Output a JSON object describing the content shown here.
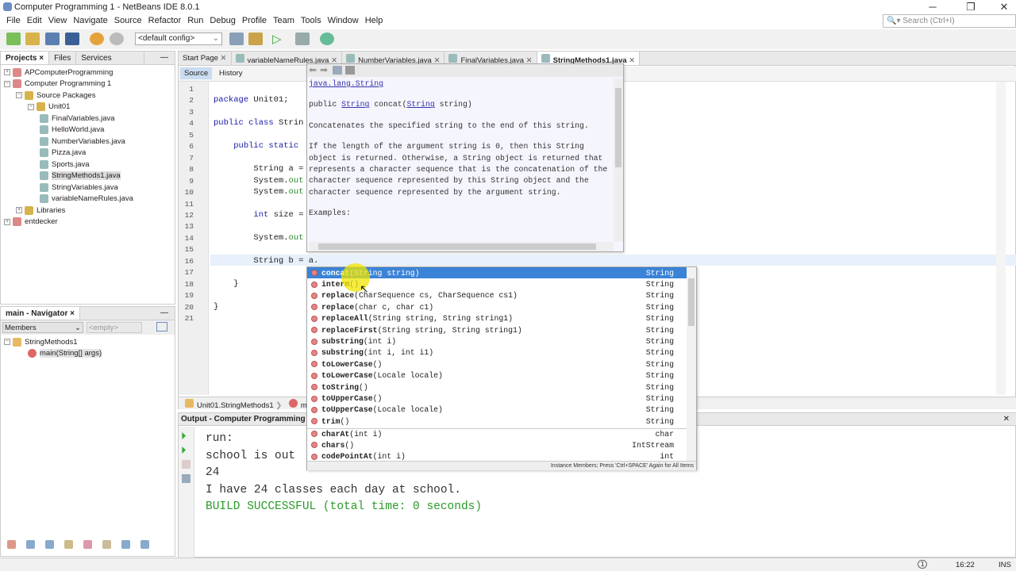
{
  "window": {
    "title": "Computer Programming 1 - NetBeans IDE 8.0.1",
    "min": "─",
    "max": "❐",
    "close": "✕"
  },
  "menu": [
    "File",
    "Edit",
    "View",
    "Navigate",
    "Source",
    "Refactor",
    "Run",
    "Debug",
    "Profile",
    "Team",
    "Tools",
    "Window",
    "Help"
  ],
  "search": {
    "placeholder": "Search (Ctrl+I)"
  },
  "toolbar": {
    "config": "<default config>"
  },
  "projects": {
    "tabs": [
      "Projects",
      "Files",
      "Services"
    ],
    "tree": [
      {
        "label": "APComputerProgramming",
        "level": 0
      },
      {
        "label": "Computer Programming 1",
        "level": 0
      },
      {
        "label": "Source Packages",
        "level": 1
      },
      {
        "label": "Unit01",
        "level": 2
      },
      {
        "label": "FinalVariables.java",
        "level": 3
      },
      {
        "label": "HelloWorld.java",
        "level": 3
      },
      {
        "label": "NumberVariables.java",
        "level": 3
      },
      {
        "label": "Pizza.java",
        "level": 3
      },
      {
        "label": "Sports.java",
        "level": 3
      },
      {
        "label": "StringMethods1.java",
        "level": 3,
        "selected": true
      },
      {
        "label": "StringVariables.java",
        "level": 3
      },
      {
        "label": "variableNameRules.java",
        "level": 3
      },
      {
        "label": "Libraries",
        "level": 1
      },
      {
        "label": "entdecker",
        "level": 0
      }
    ]
  },
  "navigator": {
    "title": "main - Navigator",
    "filter": "Members",
    "empty": "<empty>",
    "class": "StringMethods1",
    "method": "main(String[] args)"
  },
  "editor": {
    "tabs": [
      "Start Page",
      "variableNameRules.java",
      "NumberVariables.java",
      "FinalVariables.java",
      "StringMethods1.java"
    ],
    "source": "Source",
    "history": "History",
    "lines": [
      "",
      "package Unit01;",
      "",
      "public class Strin",
      "",
      "    public static ",
      "",
      "        String a = ",
      "        System.out",
      "        System.out",
      "",
      "        int size = ",
      "",
      "        System.out",
      "",
      "        String b = a.",
      "",
      "    }",
      "",
      "}",
      ""
    ],
    "breadcrumb": [
      "Unit01.StringMethods1",
      "ma"
    ]
  },
  "javadoc": {
    "pkg": "java.lang.String",
    "sig_pre": "public ",
    "sig_type": "String",
    "sig_mid": " concat(",
    "sig_ptype": "String",
    "sig_post": " string)",
    "desc": "Concatenates the specified string to the end of this string.",
    "detail": "If the length of the argument string is 0, then this String object is returned. Otherwise, a String object is returned that represents a character sequence that is the concatenation of the character sequence represented by this String object and the character sequence represented by the argument string.",
    "examples": "Examples:"
  },
  "completion": {
    "items": [
      {
        "name": "concat",
        "params": "(String string)",
        "ret": "String"
      },
      {
        "name": "intern",
        "params": "()",
        "ret": "String"
      },
      {
        "name": "replace",
        "params": "(CharSequence cs, CharSequence cs1)",
        "ret": "String"
      },
      {
        "name": "replace",
        "params": "(char c, char c1)",
        "ret": "String"
      },
      {
        "name": "replaceAll",
        "params": "(String string, String string1)",
        "ret": "String"
      },
      {
        "name": "replaceFirst",
        "params": "(String string, String string1)",
        "ret": "String"
      },
      {
        "name": "substring",
        "params": "(int i)",
        "ret": "String"
      },
      {
        "name": "substring",
        "params": "(int i, int i1)",
        "ret": "String"
      },
      {
        "name": "toLowerCase",
        "params": "()",
        "ret": "String"
      },
      {
        "name": "toLowerCase",
        "params": "(Locale locale)",
        "ret": "String"
      },
      {
        "name": "toString",
        "params": "()",
        "ret": "String"
      },
      {
        "name": "toUpperCase",
        "params": "()",
        "ret": "String"
      },
      {
        "name": "toUpperCase",
        "params": "(Locale locale)",
        "ret": "String"
      },
      {
        "name": "trim",
        "params": "()",
        "ret": "String"
      },
      {
        "name": "charAt",
        "params": "(int i)",
        "ret": "char"
      },
      {
        "name": "chars",
        "params": "()",
        "ret": "IntStream"
      },
      {
        "name": "codePointAt",
        "params": "(int i)",
        "ret": "int"
      }
    ],
    "footer": "Instance Members; Press 'Ctrl+SPACE' Again for All Items"
  },
  "output": {
    "title": "Output - Computer Programming 1 (",
    "lines": [
      "run:",
      "school is out",
      "24",
      "I have 24 classes each day at school.",
      "BUILD SUCCESSFUL (total time: 0 seconds)"
    ]
  },
  "status": {
    "notifications": "1",
    "position": "16:22",
    "mode": "INS"
  }
}
